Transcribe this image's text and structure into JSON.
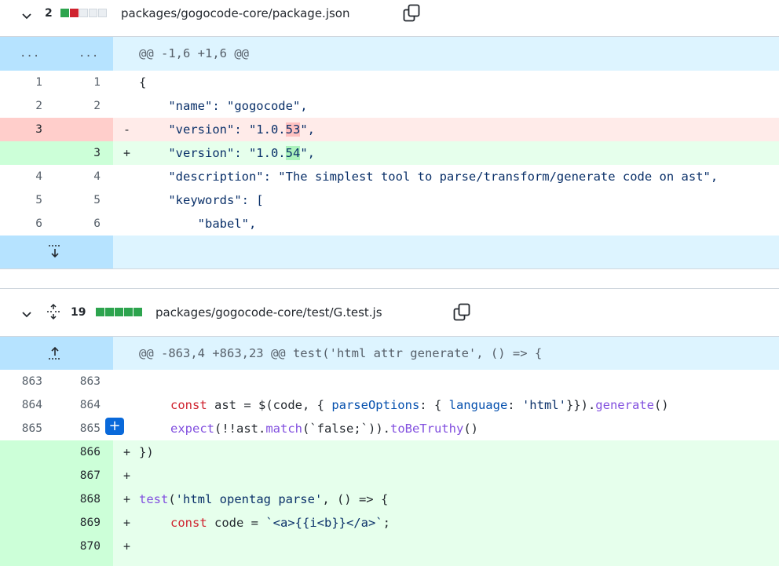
{
  "file1": {
    "count": "2",
    "path": "packages/gogocode-core/package.json",
    "blocks": [
      "green",
      "red",
      "neutral",
      "neutral",
      "neutral"
    ],
    "hunk": "@@ -1,6 +1,6 @@",
    "hunk_dots": "...",
    "lines": [
      {
        "l": "1",
        "r": "1",
        "sign": "",
        "code": "{"
      },
      {
        "l": "2",
        "r": "2",
        "sign": "",
        "code": "    \"name\": \"gogocode\","
      },
      {
        "l": "3",
        "r": "",
        "sign": "-",
        "code_a": "    \"version\": \"1.0.",
        "code_hl": "53",
        "code_b": "\","
      },
      {
        "l": "",
        "r": "3",
        "sign": "+",
        "code_a": "    \"version\": \"1.0.",
        "code_hl": "54",
        "code_b": "\","
      },
      {
        "l": "4",
        "r": "4",
        "sign": "",
        "code": "    \"description\": \"The simplest tool to parse/transform/generate code on ast\","
      },
      {
        "l": "5",
        "r": "5",
        "sign": "",
        "code": "    \"keywords\": ["
      },
      {
        "l": "6",
        "r": "6",
        "sign": "",
        "code": "        \"babel\","
      }
    ]
  },
  "file2": {
    "count": "19",
    "path": "packages/gogocode-core/test/G.test.js",
    "blocks": [
      "green",
      "green",
      "green",
      "green",
      "green"
    ],
    "hunk": "@@ -863,4 +863,23 @@ test('html attr generate', () => {",
    "lines": [
      {
        "l": "863",
        "r": "863",
        "sign": ""
      },
      {
        "l": "864",
        "r": "864",
        "sign": ""
      },
      {
        "l": "865",
        "r": "865",
        "sign": ""
      },
      {
        "l": "",
        "r": "866",
        "sign": "+"
      },
      {
        "l": "",
        "r": "867",
        "sign": "+"
      },
      {
        "l": "",
        "r": "868",
        "sign": "+"
      },
      {
        "l": "",
        "r": "869",
        "sign": "+"
      },
      {
        "l": "",
        "r": "870",
        "sign": "+"
      }
    ],
    "code864": {
      "a": "const",
      "b": " ast = $(code, { ",
      "c": "parseOptions",
      "d": ": { ",
      "e": "language",
      "f": ": ",
      "g": "'html'",
      "h": "}}).",
      "i": "generate",
      "j": "()"
    },
    "code865": {
      "a": "expect",
      "b": "(!!ast.",
      "c": "match",
      "d": "(`false;`)).",
      "e": "toBeTruthy",
      "f": "()"
    },
    "code866": "})",
    "code868": {
      "a": "test",
      "b": "(",
      "c": "'html opentag parse'",
      "d": ", () => {"
    },
    "code869": {
      "a": "const",
      "b": " code = ",
      "c": "`<a>{{i<b}}</a>`",
      "d": ";"
    }
  },
  "colors": {
    "added": "#e6ffec",
    "deleted": "#ffebe9",
    "hunk": "#ddf4ff",
    "accent": "#0969da"
  }
}
